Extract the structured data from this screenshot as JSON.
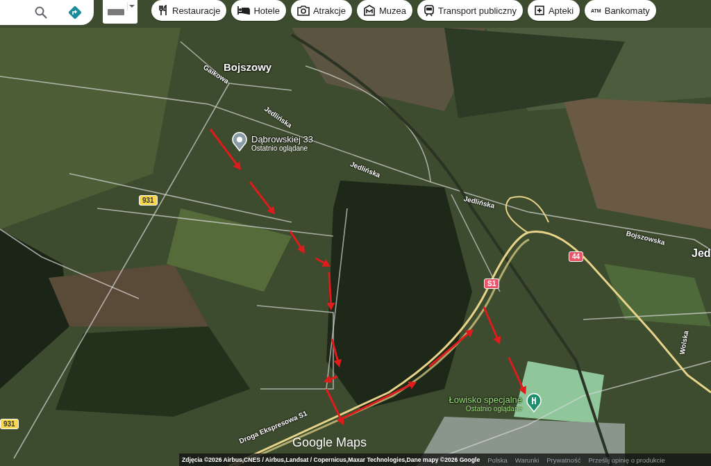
{
  "top_bar": {
    "chips": [
      {
        "label": "Restauracje",
        "kind": "restaurant"
      },
      {
        "label": "Hotele",
        "kind": "hotel"
      },
      {
        "label": "Atrakcje",
        "kind": "attraction"
      },
      {
        "label": "Muzea",
        "kind": "museum"
      },
      {
        "label": "Transport publiczny",
        "kind": "transit"
      },
      {
        "label": "Apteki",
        "kind": "pharmacy"
      },
      {
        "label": "Bankomaty",
        "kind": "atm",
        "icon_text": "ATM"
      }
    ]
  },
  "map": {
    "place_labels": [
      {
        "text": "Bojszowy"
      },
      {
        "text": "Jed"
      }
    ],
    "street_labels": [
      {
        "text": "Gaikowa"
      },
      {
        "text": "Jedlińska"
      },
      {
        "text": "Jedlińska"
      },
      {
        "text": "Jedlińska"
      },
      {
        "text": "Bojszowska"
      },
      {
        "text": "Droga Ekspresowa S1"
      },
      {
        "text": "Wolska"
      }
    ],
    "road_shields": [
      {
        "text": "931",
        "color": "#f9d74c"
      },
      {
        "text": "931",
        "color": "#f9d74c"
      },
      {
        "text": "S1",
        "color": "#e8566a"
      },
      {
        "text": "44",
        "color": "#e8566a"
      }
    ],
    "pins": [
      {
        "title": "Dąbrowskiej 33",
        "subtitle": "Ostatnio oglądane",
        "color": "#8a9ba8"
      },
      {
        "title": "Łowisko specjalne",
        "subtitle": "Ostatnio oglądane",
        "color": "#1e8e6e"
      }
    ],
    "logo": "Google Maps"
  },
  "footer": {
    "attribution": "Zdjęcia ©2026 Airbus,CNES / Airbus,Landsat / Copernicus,Maxar Technologies,Dane mapy ©2026 Google",
    "links": [
      "Polska",
      "Warunki",
      "Prywatność",
      "Prześlij opinię o produkcie"
    ]
  }
}
